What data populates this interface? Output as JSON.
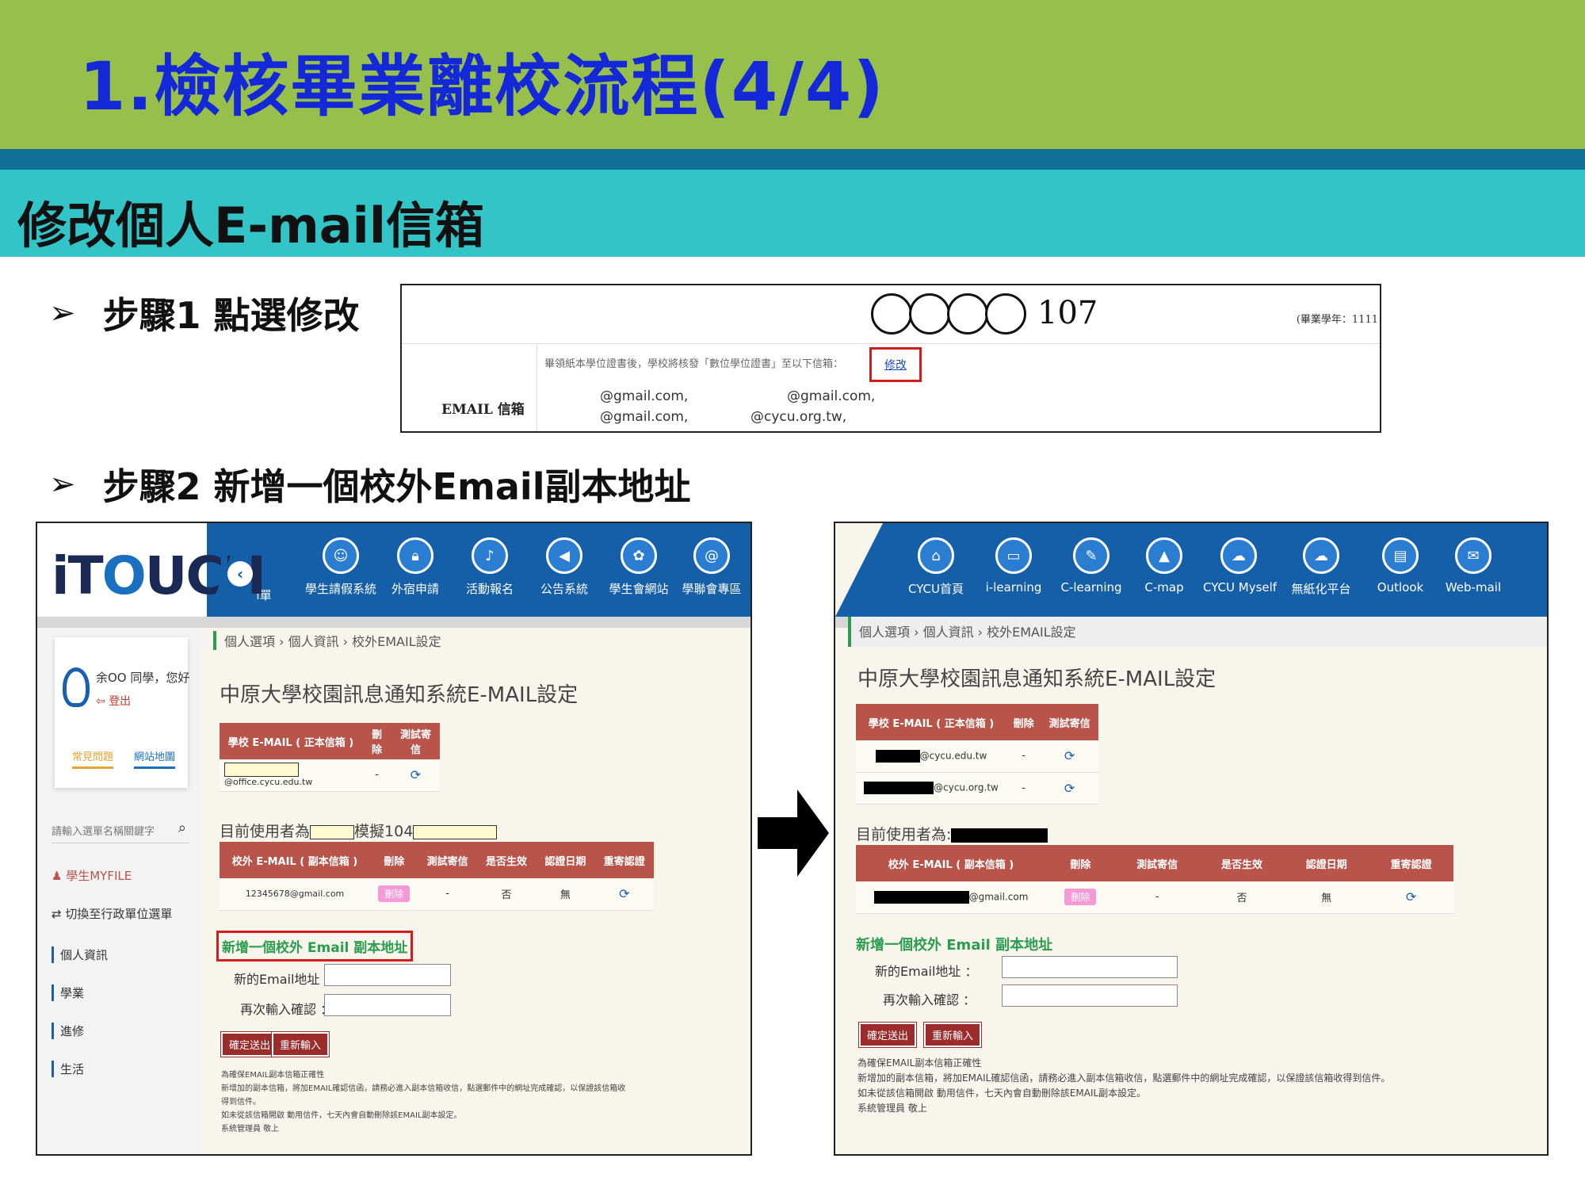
{
  "slide": {
    "title": "1.檢核畢業離校流程(4/4)",
    "subtitle": "修改個人E-mail信箱",
    "step1": "步驟1  點選修改",
    "step2": "步驟2  新增一個校外Email副本地址",
    "arrow_glyph": "➢",
    "colors": {
      "title_band": "#97bf4c",
      "title_text": "#1528d8",
      "sub_band": "#33c4c8",
      "strip": "#0f6f95"
    }
  },
  "step1_capture": {
    "year": "107",
    "note_right": "(畢業學年：1111",
    "email_label": "EMAIL 信箱",
    "hint": "畢領紙本學位證書後，學校將核發「數位學位證書」至以下信箱：",
    "edit_link": "修改",
    "emails": [
      "@gmail.com,",
      "@gmail.com,",
      "@gmail.com,",
      "@cycu.org.tw,"
    ]
  },
  "left_shot": {
    "logo": "iT",
    "logo_o": "O",
    "logo_tail": "UCH",
    "nav": [
      {
        "label": "i單",
        "icon": ""
      },
      {
        "label": "學生請假系統",
        "icon": "person-icon"
      },
      {
        "label": "外宿申請",
        "icon": "lock-icon"
      },
      {
        "label": "活動報名",
        "icon": "bell-icon"
      },
      {
        "label": "公告系統",
        "icon": "megaphone-icon"
      },
      {
        "label": "學生會網站",
        "icon": "group-icon"
      },
      {
        "label": "學聯會專區",
        "icon": "at-icon"
      }
    ],
    "user_greet": "余OO 同學，您好",
    "logout": "登出",
    "faq": "常見問題",
    "sitemap": "網站地圖",
    "search_placeholder": "請輸入選單名稱關鍵字",
    "myfile": "學生MYFILE",
    "switch_unit": "切換至行政單位選單",
    "menu": [
      "個人資訊",
      "學業",
      "進修",
      "生活"
    ],
    "breadcrumb": "個人選項 › 個人資訊 › 校外EMAIL設定",
    "page_title": "中原大學校園訊息通知系統E-MAIL設定",
    "school_table": {
      "headers": [
        "學校 E-MAIL ( 正本信箱 )",
        "刪除",
        "測試寄信"
      ],
      "rows": [
        {
          "email": "@office.cycu.edu.tw",
          "del": "-"
        }
      ]
    },
    "current_user_prefix": "目前使用者為",
    "current_user_mid": "模擬104",
    "ext_table": {
      "headers": [
        "校外 E-MAIL ( 副本信箱 )",
        "刪除",
        "測試寄信",
        "是否生效",
        "認證日期",
        "重寄認證"
      ],
      "rows": [
        {
          "email": "12345678@gmail.com",
          "del": "刪除",
          "test": "-",
          "active": "否",
          "date": "無"
        }
      ]
    },
    "add_title": "新增一個校外 Email 副本地址",
    "new_email_label": "新的Email地址 ：",
    "confirm_label": "再次輸入確認 ：",
    "submit": "確定送出",
    "reset": "重新輸入",
    "notice": [
      "為確保EMAIL副本信箱正確性",
      "新增加的副本信箱，將加EMAIL確認信函，請務必進入副本信箱收信，點選郵件中的網址完成確認，以保證該信箱收得到信件。",
      "如未從該信箱開啟 動用信件，七天內會自動刪除該EMAIL副本設定。",
      "系統管理員 敬上"
    ]
  },
  "right_shot": {
    "nav": [
      {
        "label": "CYCU首頁",
        "icon": "home-icon"
      },
      {
        "label": "i-learning",
        "icon": "monitor-icon"
      },
      {
        "label": "C-learning",
        "icon": "edit-icon"
      },
      {
        "label": "C-map",
        "icon": "mountain-icon"
      },
      {
        "label": "CYCU Myself",
        "icon": "cloud-icon"
      },
      {
        "label": "無紙化平台",
        "icon": "cloud-icon"
      },
      {
        "label": "Outlook",
        "icon": "print-icon"
      },
      {
        "label": "Web-mail",
        "icon": "mail-icon"
      }
    ],
    "breadcrumb": "個人選項 › 個人資訊 › 校外EMAIL設定",
    "page_title": "中原大學校園訊息通知系統E-MAIL設定",
    "school_table": {
      "headers": [
        "學校 E-MAIL ( 正本信箱 )",
        "刪除",
        "測試寄信"
      ],
      "rows": [
        {
          "email": "@cycu.edu.tw",
          "del": "-"
        },
        {
          "email": "@cycu.org.tw",
          "del": "-"
        }
      ]
    },
    "current_user_prefix": "目前使用者為:",
    "ext_table": {
      "headers": [
        "校外 E-MAIL ( 副本信箱 )",
        "刪除",
        "測試寄信",
        "是否生效",
        "認證日期",
        "重寄認證"
      ],
      "rows": [
        {
          "email": "@gmail.com",
          "del": "刪除",
          "test": "-",
          "active": "否",
          "date": "無"
        }
      ]
    },
    "add_title": "新增一個校外 Email 副本地址",
    "new_email_label": "新的Email地址 ：",
    "confirm_label": "再次輸入確認 ：",
    "submit": "確定送出",
    "reset": "重新輸入",
    "notice": [
      "為確保EMAIL副本信箱正確性",
      "新增加的副本信箱，將加EMAIL確認信函，請務必進入副本信箱收信，點選郵件中的網址完成確認，以保證該信箱收得到信件。",
      "如未從該信箱開啟 動用信件，七天內會自動刪除該EMAIL副本設定。",
      "系統管理員 敬上"
    ]
  }
}
